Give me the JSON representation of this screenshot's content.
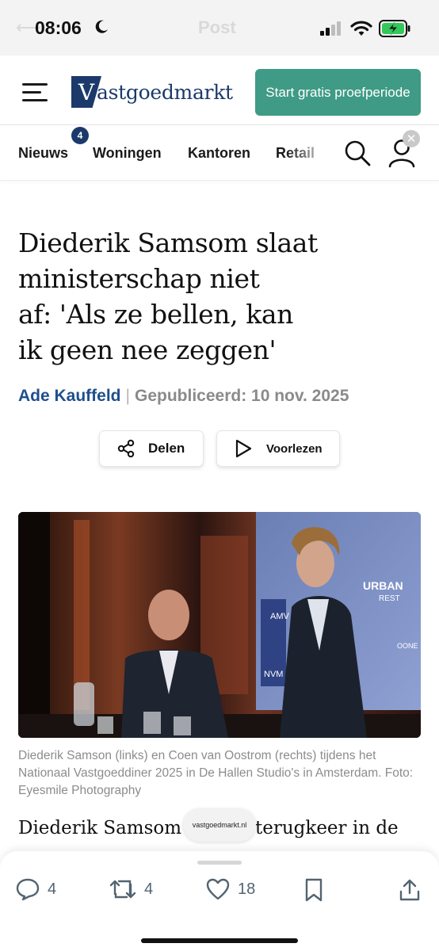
{
  "status_bar": {
    "time": "08:06",
    "ghost_title": "Post",
    "icons": [
      "moon-icon",
      "signal-icon",
      "wifi-icon",
      "battery-charging-icon"
    ]
  },
  "header": {
    "logo_letter": "V",
    "logo_text": "astgoedmarkt",
    "cta_label": "Start gratis proefperiode",
    "brand_color": "#1b3a6b",
    "cta_color": "#3f9b85"
  },
  "nav": {
    "items": [
      "Nieuws",
      "Woningen",
      "Kantoren",
      "Retail"
    ],
    "news_badge": "4"
  },
  "article": {
    "title_lines": [
      "Diederik Samsom slaat",
      "ministerschap niet",
      "af: 'Als ze bellen, kan",
      "ik geen nee zeggen'"
    ],
    "author": "Ade Kauffeld",
    "separator": "|",
    "published": "Gepubliceerd: 10 nov. 2025",
    "share_label": "Delen",
    "read_aloud_label": "Voorlezen",
    "caption": "Diederik Samson (links) en Coen van Oostrom (rechts) tijdens het Nationaal Vastgoeddiner 2025 in De Hallen Studio's in Amsterdam. Foto: Eyesmile Photography",
    "body_start_left": "Diederik Samsom",
    "body_start_right": "terugkeer in de",
    "photo_screen_text": [
      "AMV",
      "URBAN",
      "REST",
      "NVM",
      "OONE"
    ]
  },
  "url_pill": "vastgoedmarkt.nl",
  "actions": {
    "replies": "4",
    "reposts": "4",
    "likes": "18"
  }
}
